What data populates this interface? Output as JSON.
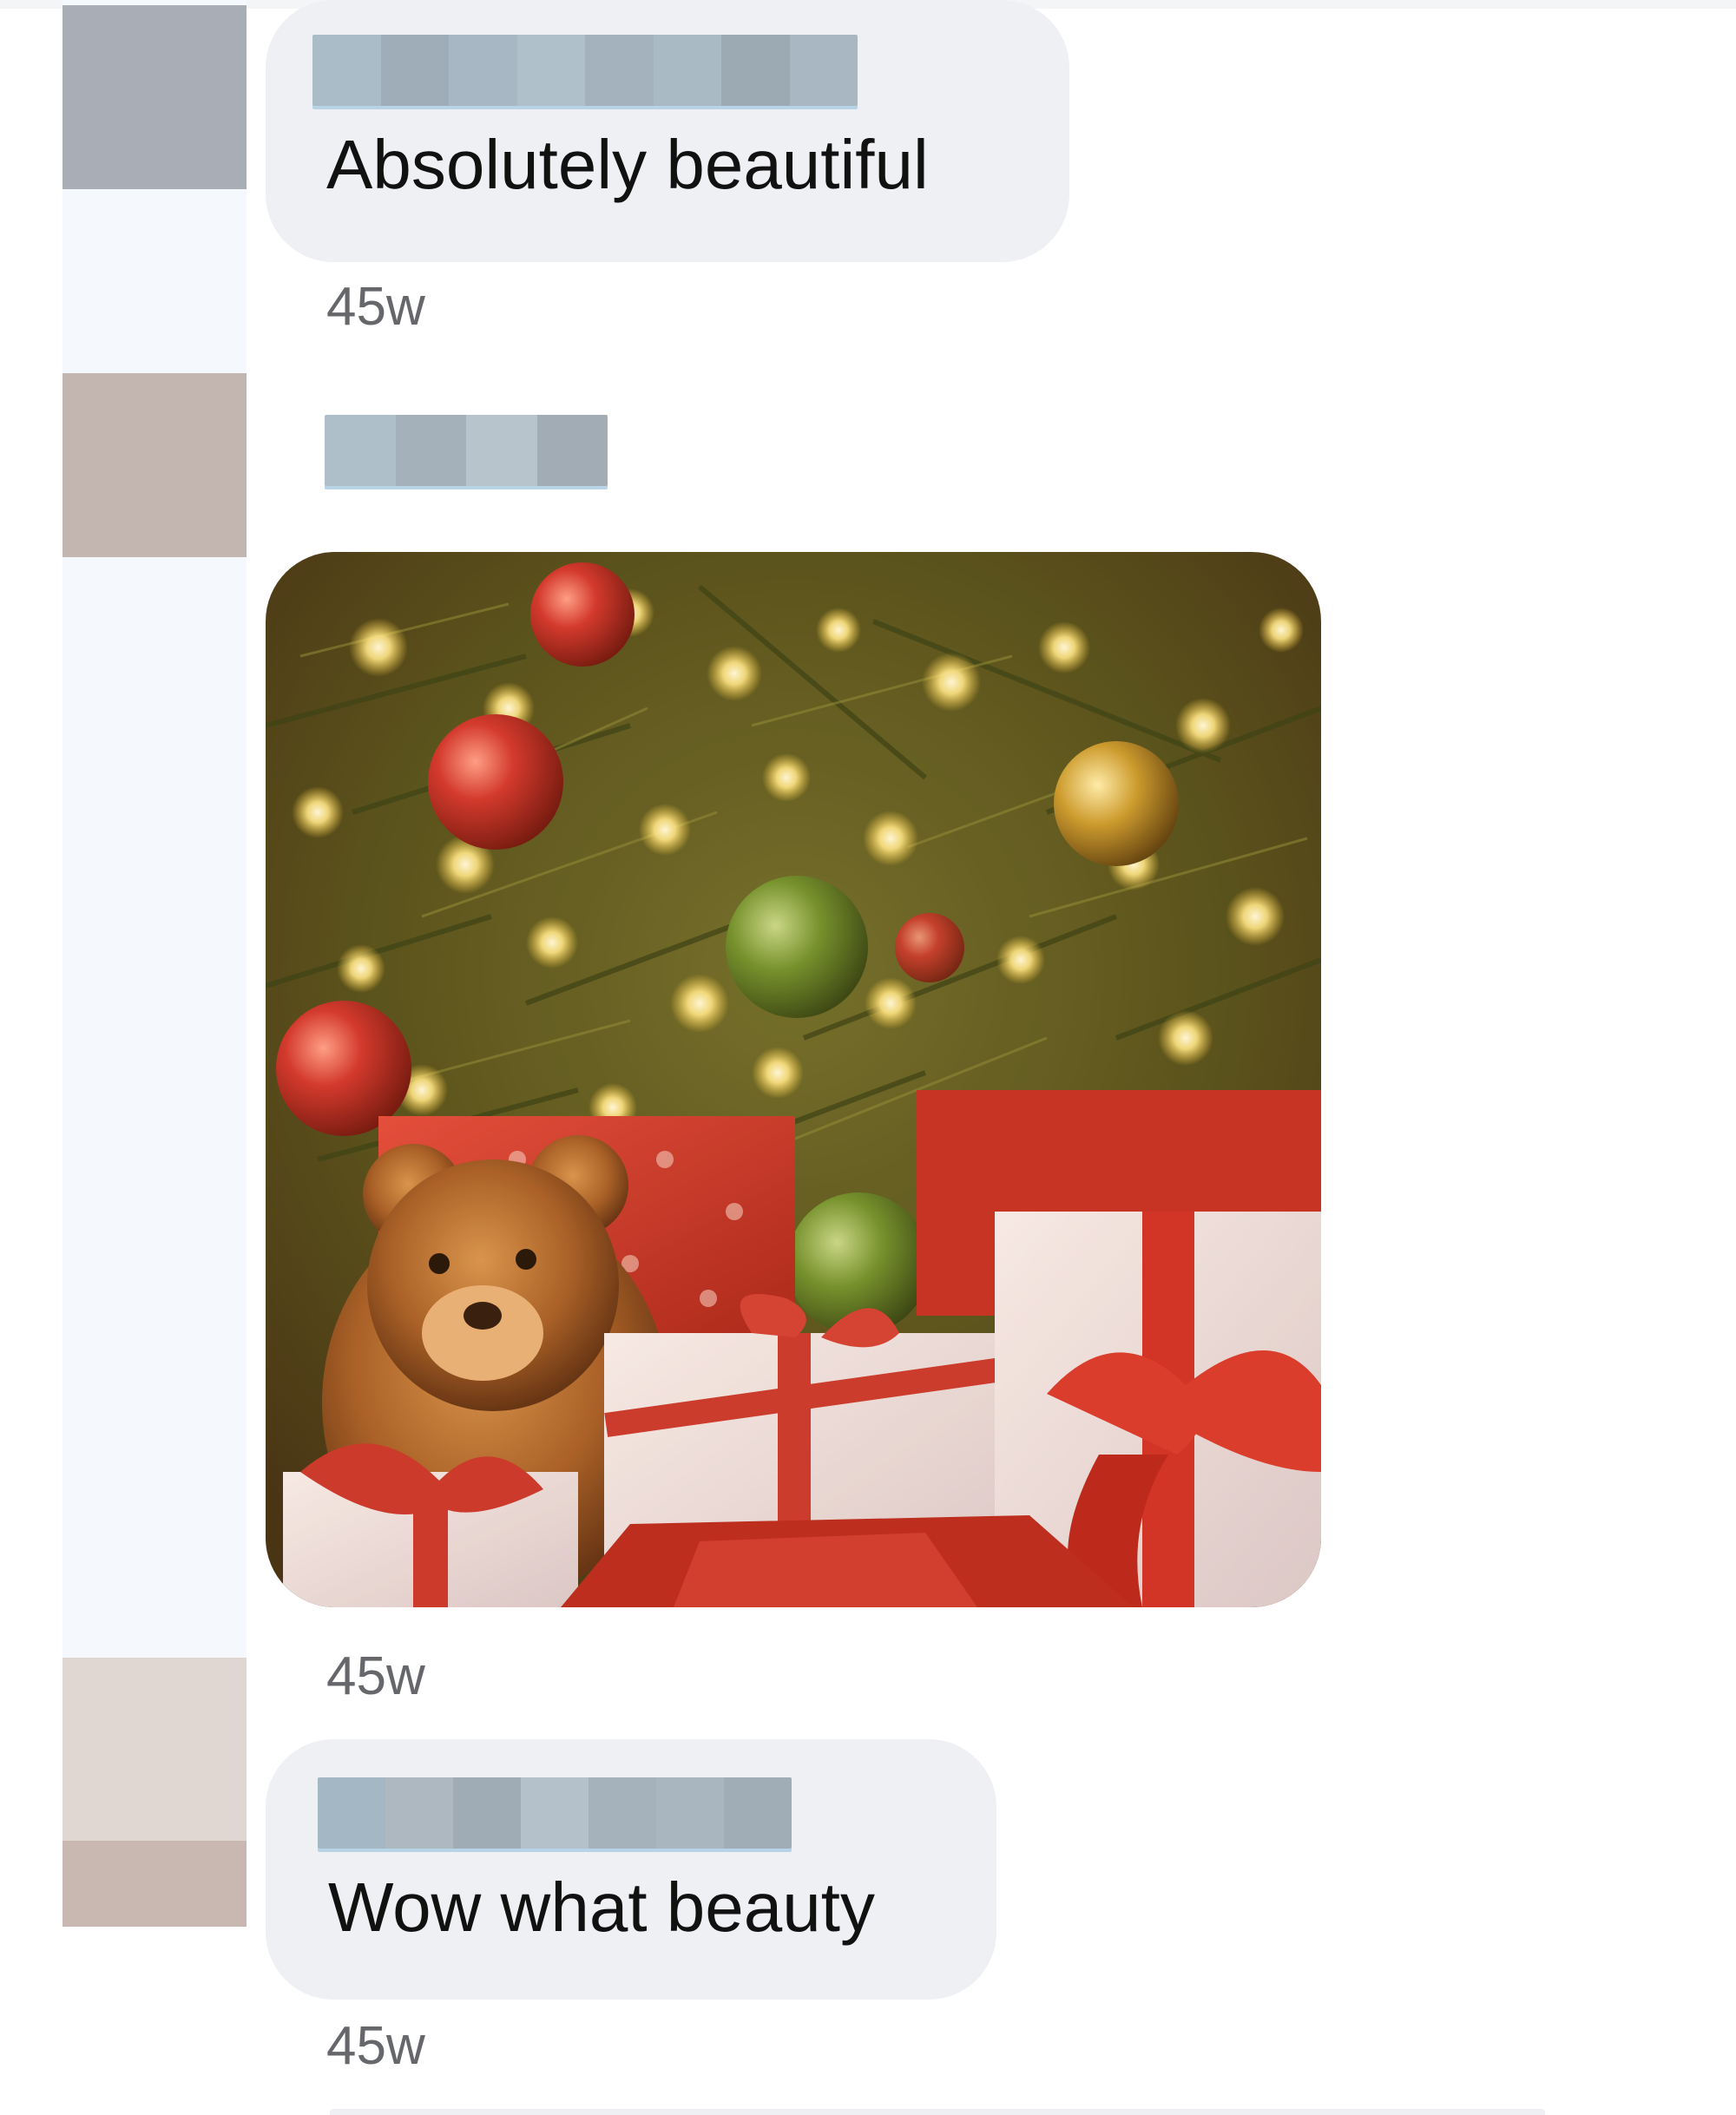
{
  "comments": [
    {
      "author_redacted": true,
      "text": "Absolutely beautiful",
      "time": "45w"
    },
    {
      "author_redacted": true,
      "image": "christmas-tree-gifts-teddy-bear-photo",
      "time": "45w"
    },
    {
      "author_redacted": true,
      "text": "Wow what beauty",
      "time": "45w"
    }
  ],
  "colors": {
    "bubble": "#eff0f4",
    "timestamp": "#65676b",
    "text": "#111111"
  }
}
